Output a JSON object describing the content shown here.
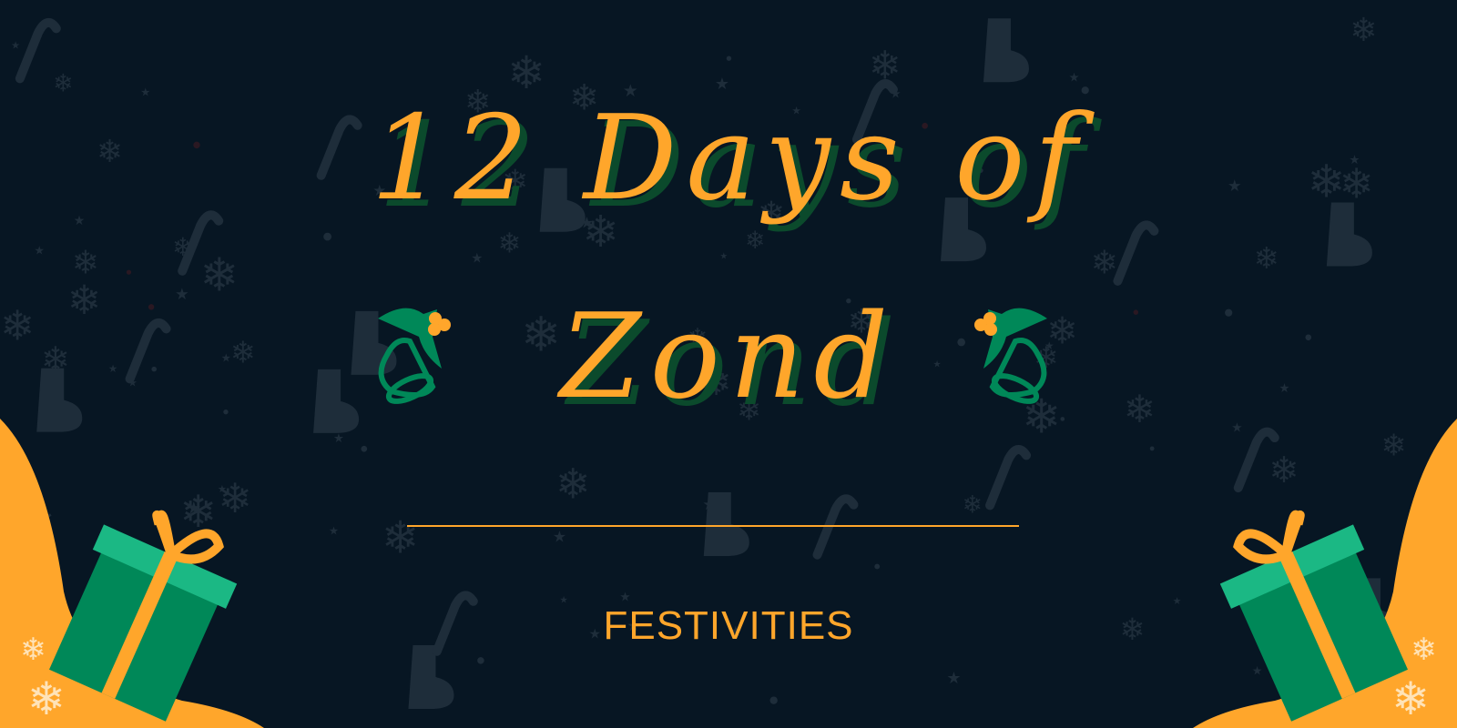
{
  "banner": {
    "title_line1": "12 Days of",
    "title_line2": "Zond",
    "subtitle": "FESTIVITIES"
  },
  "colors": {
    "background": "#071623",
    "accent": "#FFA62B",
    "title_shadow": "#0B4A2C",
    "gift_green": "#008858",
    "gift_lid": "#1BB884",
    "pattern": "#1E2D3A"
  },
  "icons": [
    "stocking-icon",
    "candy-cane-icon",
    "gingerbread-icon",
    "snowflake-icon",
    "star-icon",
    "holly-bell-icon",
    "gift-icon"
  ]
}
